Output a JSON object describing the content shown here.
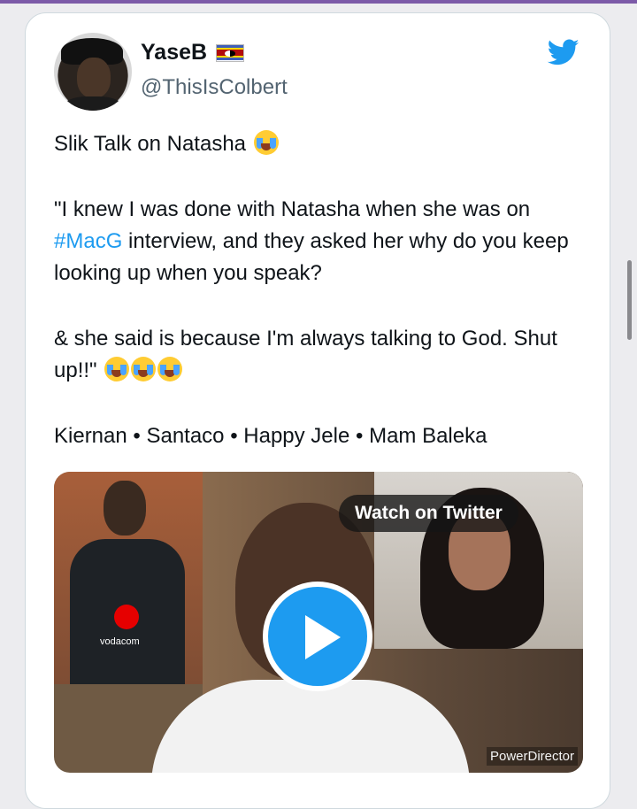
{
  "tweet": {
    "display_name": "YaseB",
    "handle": "@ThisIsColbert",
    "text_line1": "Slik Talk on Natasha",
    "quote_part1": "\"I knew I was done with Natasha when she was on ",
    "hashtag": "#MacG",
    "quote_part2": " interview, and they asked her why do you keep looking up when you speak?",
    "quote_line3": "& she said is because I'm always talking to God. Shut up!!\"",
    "tags_line": "Kiernan • Santaco • Happy Jele • Mam Baleka"
  },
  "video": {
    "watch_label": "Watch on Twitter",
    "watermark": "PowerDirector",
    "jersey_text": "vodacom"
  },
  "icons": {
    "bird": "twitter-bird-icon",
    "flag": "eswatini-flag-icon",
    "laugh": "face-with-tears-of-joy-icon",
    "cry": "loudly-crying-face-icon",
    "play": "play-icon"
  },
  "colors": {
    "accent": "#1d9bf0",
    "handle": "#536471",
    "text": "#0f1419"
  }
}
